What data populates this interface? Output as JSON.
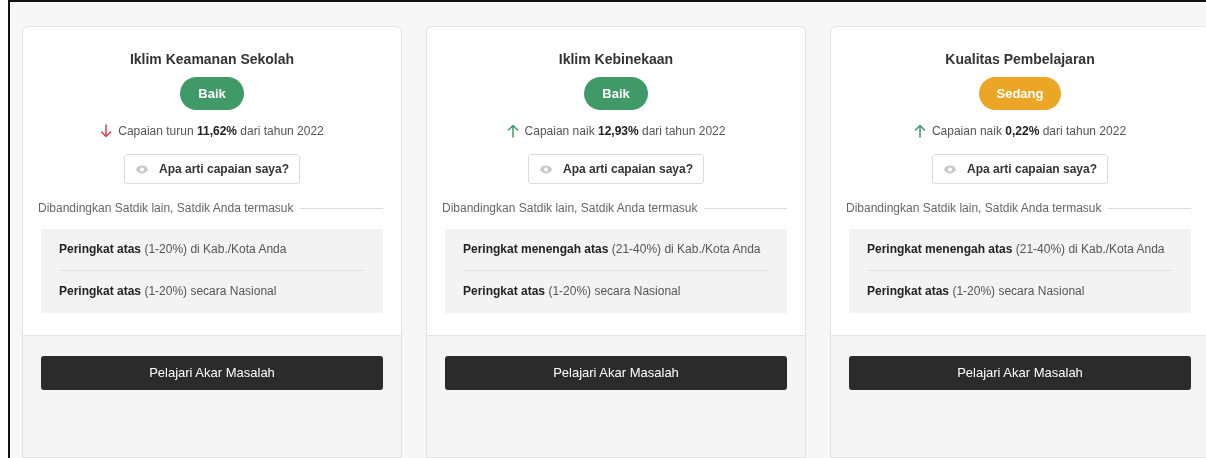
{
  "cards": [
    {
      "title": "Iklim Keamanan Sekolah",
      "status": {
        "label": "Baik",
        "color": "#3f9a68"
      },
      "trend": {
        "kind": "down",
        "text": "Capaian turun **11,62%** dari tahun 2022"
      },
      "help_button": "Apa arti capaian saya?",
      "comparison_label": "Dibandingkan Satdik lain, Satdik Anda termasuk",
      "rankings": [
        "**Peringkat atas** (1-20%) di Kab./Kota Anda",
        "**Peringkat atas** (1-20%) secara Nasional"
      ],
      "action_button": "Pelajari Akar Masalah"
    },
    {
      "title": "Iklim Kebinekaan",
      "status": {
        "label": "Baik",
        "color": "#3f9a68"
      },
      "trend": {
        "kind": "up",
        "text": "Capaian naik **12,93%** dari tahun 2022"
      },
      "help_button": "Apa arti capaian saya?",
      "comparison_label": "Dibandingkan Satdik lain, Satdik Anda termasuk",
      "rankings": [
        "**Peringkat menengah atas** (21-40%) di Kab./Kota Anda",
        "**Peringkat atas** (1-20%) secara Nasional"
      ],
      "action_button": "Pelajari Akar Masalah"
    },
    {
      "title": "Kualitas Pembelajaran",
      "status": {
        "label": "Sedang",
        "color": "#eaa624"
      },
      "trend": {
        "kind": "up",
        "text": "Capaian naik **0,22%** dari tahun 2022"
      },
      "help_button": "Apa arti capaian saya?",
      "comparison_label": "Dibandingkan Satdik lain, Satdik Anda termasuk",
      "rankings": [
        "**Peringkat menengah atas** (21-40%) di Kab./Kota Anda",
        "**Peringkat atas** (1-20%) secara Nasional"
      ],
      "action_button": "Pelajari Akar Masalah"
    }
  ]
}
